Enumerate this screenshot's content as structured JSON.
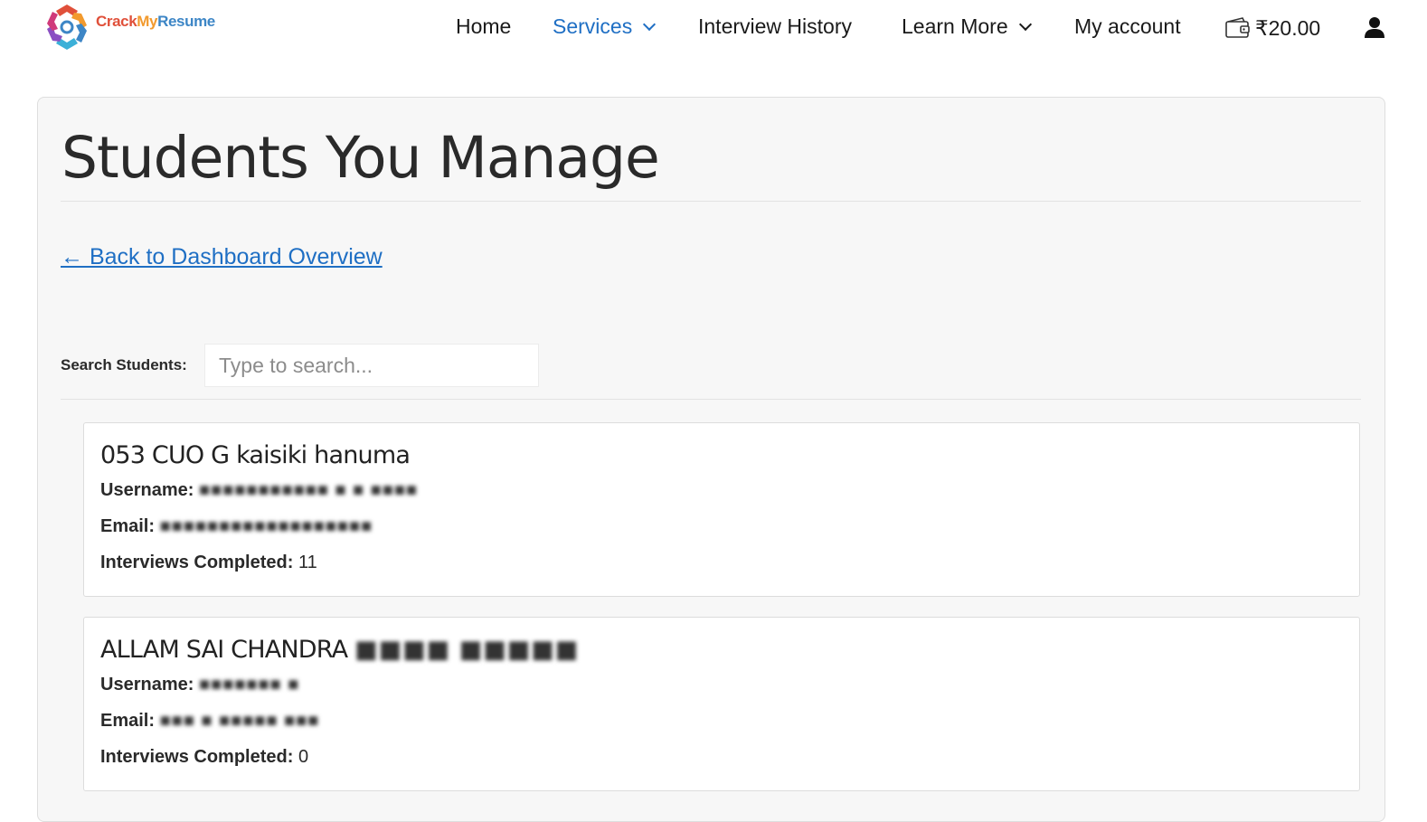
{
  "brand": {
    "logo_part1": "Crack",
    "logo_part2": "My",
    "logo_part3": "Resume"
  },
  "nav": {
    "home": "Home",
    "services": "Services",
    "interview_history": "Interview History",
    "learn_more": "Learn More",
    "my_account": "My account",
    "wallet_balance": "₹20.00"
  },
  "page": {
    "title": "Students You Manage",
    "back_link": "← Back to Dashboard Overview",
    "search_label": "Search Students:",
    "search_placeholder": "Type to search..."
  },
  "labels": {
    "username": "Username:",
    "email": "Email:",
    "interviews_completed": "Interviews Completed:"
  },
  "students": [
    {
      "name": "053 CUO G kaisiki hanuma",
      "username": "",
      "email": "",
      "interviews_completed": "11"
    },
    {
      "name": "ALLAM SAI CHANDRA",
      "username": "",
      "email": "",
      "interviews_completed": "0"
    }
  ],
  "colors": {
    "accent": "#1f6fc4",
    "card_bg": "#f7f7f7"
  },
  "icons": {
    "services_chevron": "chevron-down-icon",
    "learn_more_chevron": "chevron-down-icon",
    "wallet": "wallet-icon",
    "user": "user-icon"
  }
}
